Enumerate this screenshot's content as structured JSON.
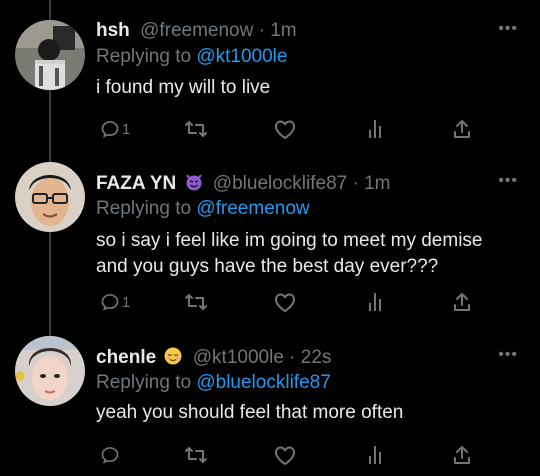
{
  "tweets": [
    {
      "name": "hsh",
      "handle": "@freemenow",
      "sep": "·",
      "time": "1m",
      "reply_prefix": "Replying to ",
      "reply_to": "@kt1000le",
      "text": "i found my will to live",
      "reply_count": "1",
      "more": "•••"
    },
    {
      "name": "FAZA YN",
      "emoji": "smiling-imp-emoji",
      "handle": "@bluelocklife87",
      "sep": "·",
      "time": "1m",
      "reply_prefix": "Replying to ",
      "reply_to": "@freemenow",
      "text_line1": "so i say i feel like im going to meet my demise",
      "text_line2": "and you guys have the best day ever???",
      "reply_count": "1",
      "more": "•••"
    },
    {
      "name": "chenle",
      "emoji": "relieved-face-emoji",
      "handle": "@kt1000le",
      "sep": "·",
      "time": "22s",
      "reply_prefix": "Replying to ",
      "reply_to": "@bluelocklife87",
      "text": "yeah you should feel that more often",
      "reply_count": "",
      "more": "•••"
    }
  ],
  "colors": {
    "background": "#000000",
    "text": "#e7e9ea",
    "muted": "#71767b",
    "mention": "#1d9bf0"
  }
}
